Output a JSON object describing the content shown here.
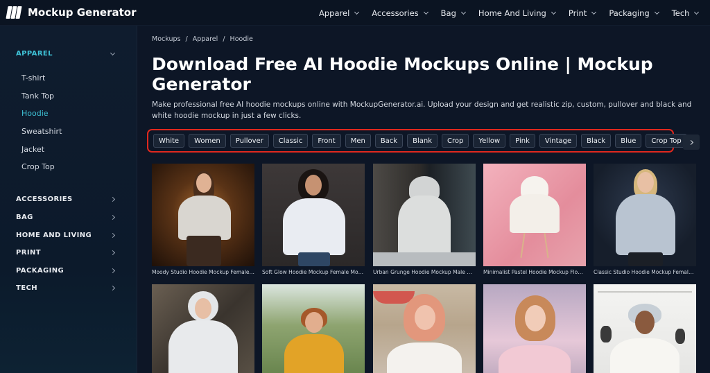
{
  "brand": {
    "name": "Mockup Generator"
  },
  "topnav": [
    "Apparel",
    "Accessories",
    "Bag",
    "Home And Living",
    "Print",
    "Packaging",
    "Tech"
  ],
  "sidebar": {
    "groups": [
      {
        "label": "APPAREL",
        "expanded": true,
        "items": [
          "T-shirt",
          "Tank Top",
          "Hoodie",
          "Sweatshirt",
          "Jacket",
          "Crop Top"
        ],
        "active_item": "Hoodie"
      },
      {
        "label": "ACCESSORIES"
      },
      {
        "label": "BAG"
      },
      {
        "label": "HOME AND LIVING"
      },
      {
        "label": "PRINT"
      },
      {
        "label": "PACKAGING"
      },
      {
        "label": "TECH"
      }
    ]
  },
  "breadcrumb": [
    "Mockups",
    "/",
    "Apparel",
    "/",
    "Hoodie"
  ],
  "page": {
    "title": "Download Free AI Hoodie Mockups Online | Mockup Generator",
    "description": "Make professional free AI hoodie mockups online with MockupGenerator.ai. Upload your design and get realistic zip, custom, pullover and black and white hoodie mockup in just a few clicks."
  },
  "tags": [
    "White",
    "Women",
    "Pullover",
    "Classic",
    "Front",
    "Men",
    "Back",
    "Blank",
    "Crop",
    "Yellow",
    "Pink",
    "Vintage",
    "Black",
    "Blue",
    "Crop Top"
  ],
  "mockups": [
    {
      "caption": "Moody Studio Hoodie Mockup Female Model"
    },
    {
      "caption": "Soft Glow Hoodie Mockup Female Model"
    },
    {
      "caption": "Urban Grunge Hoodie Mockup Male Model"
    },
    {
      "caption": "Minimalist Pastel Hoodie Mockup Floating"
    },
    {
      "caption": "Classic Studio Hoodie Mockup Female Model"
    },
    {
      "caption": ""
    },
    {
      "caption": ""
    },
    {
      "caption": ""
    },
    {
      "caption": ""
    },
    {
      "caption": ""
    }
  ],
  "colors": {
    "accent": "#3fc3d8",
    "highlight": "#e0281e",
    "background": "#0d1626"
  }
}
